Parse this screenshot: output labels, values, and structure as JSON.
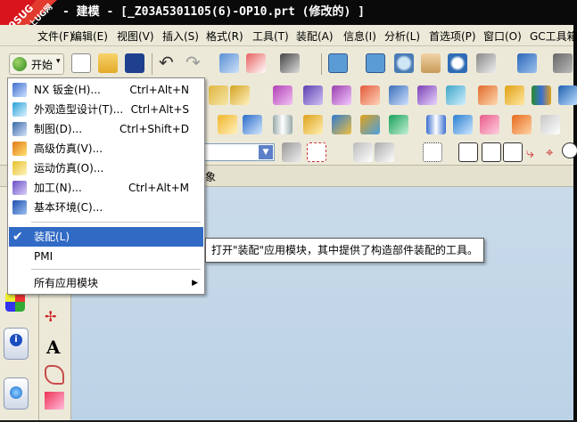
{
  "title_bar": {
    "text": "- 建模 - [_Z03A5301105(6)-OP10.prt  (修改的) ]"
  },
  "watermark": {
    "line1": "9SUG",
    "line2": "学UG就上UG网"
  },
  "menubar": {
    "items": [
      "文件(F)",
      "编辑(E)",
      "视图(V)",
      "插入(S)",
      "格式(R)",
      "工具(T)",
      "装配(A)",
      "信息(I)",
      "分析(L)",
      "首选项(P)",
      "窗口(O)",
      "GC工具箱"
    ]
  },
  "toolbar": {
    "start_label": "开始"
  },
  "start_menu": {
    "items": [
      {
        "label": "NX 钣金(H)...",
        "shortcut": "Ctrl+Alt+N",
        "icon": "sheet-metal-icon"
      },
      {
        "label": "外观造型设计(T)...",
        "shortcut": "Ctrl+Alt+S",
        "icon": "shape-studio-icon"
      },
      {
        "label": "制图(D)...",
        "shortcut": "Ctrl+Shift+D",
        "icon": "drafting-icon"
      },
      {
        "label": "高级仿真(V)...",
        "shortcut": "",
        "icon": "advanced-simulation-icon"
      },
      {
        "label": "运动仿真(O)...",
        "shortcut": "",
        "icon": "motion-simulation-icon"
      },
      {
        "label": "加工(N)...",
        "shortcut": "Ctrl+Alt+M",
        "icon": "manufacturing-icon"
      },
      {
        "label": "基本环境(C)...",
        "shortcut": "",
        "icon": "gateway-icon"
      }
    ],
    "assembly_label": "装配(L)",
    "pmi_label": "PMI",
    "all_apps_label": "所有应用模块"
  },
  "tooltip": {
    "text": "打开\"装配\"应用模块，其中提供了构造部件装配的工具。"
  },
  "tab_strip": {
    "partial_label": "象"
  },
  "colors": {
    "highlight": "#316ac5",
    "viewport": "#c4d7e9",
    "chrome": "#ece9d8",
    "titlebar": "#0a0a0a"
  }
}
